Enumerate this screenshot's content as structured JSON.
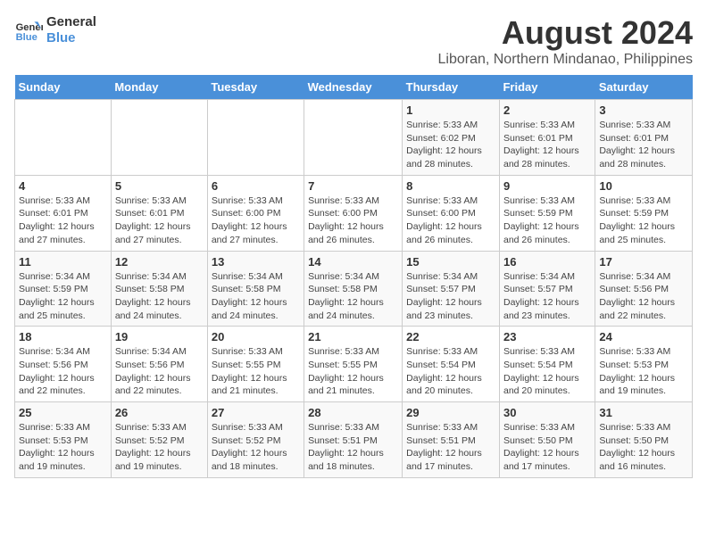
{
  "logo": {
    "line1": "General",
    "line2": "Blue"
  },
  "title": "August 2024",
  "subtitle": "Liboran, Northern Mindanao, Philippines",
  "headers": [
    "Sunday",
    "Monday",
    "Tuesday",
    "Wednesday",
    "Thursday",
    "Friday",
    "Saturday"
  ],
  "weeks": [
    [
      {
        "day": "",
        "sunrise": "",
        "sunset": "",
        "daylight": ""
      },
      {
        "day": "",
        "sunrise": "",
        "sunset": "",
        "daylight": ""
      },
      {
        "day": "",
        "sunrise": "",
        "sunset": "",
        "daylight": ""
      },
      {
        "day": "",
        "sunrise": "",
        "sunset": "",
        "daylight": ""
      },
      {
        "day": "1",
        "sunrise": "Sunrise: 5:33 AM",
        "sunset": "Sunset: 6:02 PM",
        "daylight": "Daylight: 12 hours and 28 minutes."
      },
      {
        "day": "2",
        "sunrise": "Sunrise: 5:33 AM",
        "sunset": "Sunset: 6:01 PM",
        "daylight": "Daylight: 12 hours and 28 minutes."
      },
      {
        "day": "3",
        "sunrise": "Sunrise: 5:33 AM",
        "sunset": "Sunset: 6:01 PM",
        "daylight": "Daylight: 12 hours and 28 minutes."
      }
    ],
    [
      {
        "day": "4",
        "sunrise": "Sunrise: 5:33 AM",
        "sunset": "Sunset: 6:01 PM",
        "daylight": "Daylight: 12 hours and 27 minutes."
      },
      {
        "day": "5",
        "sunrise": "Sunrise: 5:33 AM",
        "sunset": "Sunset: 6:01 PM",
        "daylight": "Daylight: 12 hours and 27 minutes."
      },
      {
        "day": "6",
        "sunrise": "Sunrise: 5:33 AM",
        "sunset": "Sunset: 6:00 PM",
        "daylight": "Daylight: 12 hours and 27 minutes."
      },
      {
        "day": "7",
        "sunrise": "Sunrise: 5:33 AM",
        "sunset": "Sunset: 6:00 PM",
        "daylight": "Daylight: 12 hours and 26 minutes."
      },
      {
        "day": "8",
        "sunrise": "Sunrise: 5:33 AM",
        "sunset": "Sunset: 6:00 PM",
        "daylight": "Daylight: 12 hours and 26 minutes."
      },
      {
        "day": "9",
        "sunrise": "Sunrise: 5:33 AM",
        "sunset": "Sunset: 5:59 PM",
        "daylight": "Daylight: 12 hours and 26 minutes."
      },
      {
        "day": "10",
        "sunrise": "Sunrise: 5:33 AM",
        "sunset": "Sunset: 5:59 PM",
        "daylight": "Daylight: 12 hours and 25 minutes."
      }
    ],
    [
      {
        "day": "11",
        "sunrise": "Sunrise: 5:34 AM",
        "sunset": "Sunset: 5:59 PM",
        "daylight": "Daylight: 12 hours and 25 minutes."
      },
      {
        "day": "12",
        "sunrise": "Sunrise: 5:34 AM",
        "sunset": "Sunset: 5:58 PM",
        "daylight": "Daylight: 12 hours and 24 minutes."
      },
      {
        "day": "13",
        "sunrise": "Sunrise: 5:34 AM",
        "sunset": "Sunset: 5:58 PM",
        "daylight": "Daylight: 12 hours and 24 minutes."
      },
      {
        "day": "14",
        "sunrise": "Sunrise: 5:34 AM",
        "sunset": "Sunset: 5:58 PM",
        "daylight": "Daylight: 12 hours and 24 minutes."
      },
      {
        "day": "15",
        "sunrise": "Sunrise: 5:34 AM",
        "sunset": "Sunset: 5:57 PM",
        "daylight": "Daylight: 12 hours and 23 minutes."
      },
      {
        "day": "16",
        "sunrise": "Sunrise: 5:34 AM",
        "sunset": "Sunset: 5:57 PM",
        "daylight": "Daylight: 12 hours and 23 minutes."
      },
      {
        "day": "17",
        "sunrise": "Sunrise: 5:34 AM",
        "sunset": "Sunset: 5:56 PM",
        "daylight": "Daylight: 12 hours and 22 minutes."
      }
    ],
    [
      {
        "day": "18",
        "sunrise": "Sunrise: 5:34 AM",
        "sunset": "Sunset: 5:56 PM",
        "daylight": "Daylight: 12 hours and 22 minutes."
      },
      {
        "day": "19",
        "sunrise": "Sunrise: 5:34 AM",
        "sunset": "Sunset: 5:56 PM",
        "daylight": "Daylight: 12 hours and 22 minutes."
      },
      {
        "day": "20",
        "sunrise": "Sunrise: 5:33 AM",
        "sunset": "Sunset: 5:55 PM",
        "daylight": "Daylight: 12 hours and 21 minutes."
      },
      {
        "day": "21",
        "sunrise": "Sunrise: 5:33 AM",
        "sunset": "Sunset: 5:55 PM",
        "daylight": "Daylight: 12 hours and 21 minutes."
      },
      {
        "day": "22",
        "sunrise": "Sunrise: 5:33 AM",
        "sunset": "Sunset: 5:54 PM",
        "daylight": "Daylight: 12 hours and 20 minutes."
      },
      {
        "day": "23",
        "sunrise": "Sunrise: 5:33 AM",
        "sunset": "Sunset: 5:54 PM",
        "daylight": "Daylight: 12 hours and 20 minutes."
      },
      {
        "day": "24",
        "sunrise": "Sunrise: 5:33 AM",
        "sunset": "Sunset: 5:53 PM",
        "daylight": "Daylight: 12 hours and 19 minutes."
      }
    ],
    [
      {
        "day": "25",
        "sunrise": "Sunrise: 5:33 AM",
        "sunset": "Sunset: 5:53 PM",
        "daylight": "Daylight: 12 hours and 19 minutes."
      },
      {
        "day": "26",
        "sunrise": "Sunrise: 5:33 AM",
        "sunset": "Sunset: 5:52 PM",
        "daylight": "Daylight: 12 hours and 19 minutes."
      },
      {
        "day": "27",
        "sunrise": "Sunrise: 5:33 AM",
        "sunset": "Sunset: 5:52 PM",
        "daylight": "Daylight: 12 hours and 18 minutes."
      },
      {
        "day": "28",
        "sunrise": "Sunrise: 5:33 AM",
        "sunset": "Sunset: 5:51 PM",
        "daylight": "Daylight: 12 hours and 18 minutes."
      },
      {
        "day": "29",
        "sunrise": "Sunrise: 5:33 AM",
        "sunset": "Sunset: 5:51 PM",
        "daylight": "Daylight: 12 hours and 17 minutes."
      },
      {
        "day": "30",
        "sunrise": "Sunrise: 5:33 AM",
        "sunset": "Sunset: 5:50 PM",
        "daylight": "Daylight: 12 hours and 17 minutes."
      },
      {
        "day": "31",
        "sunrise": "Sunrise: 5:33 AM",
        "sunset": "Sunset: 5:50 PM",
        "daylight": "Daylight: 12 hours and 16 minutes."
      }
    ]
  ]
}
